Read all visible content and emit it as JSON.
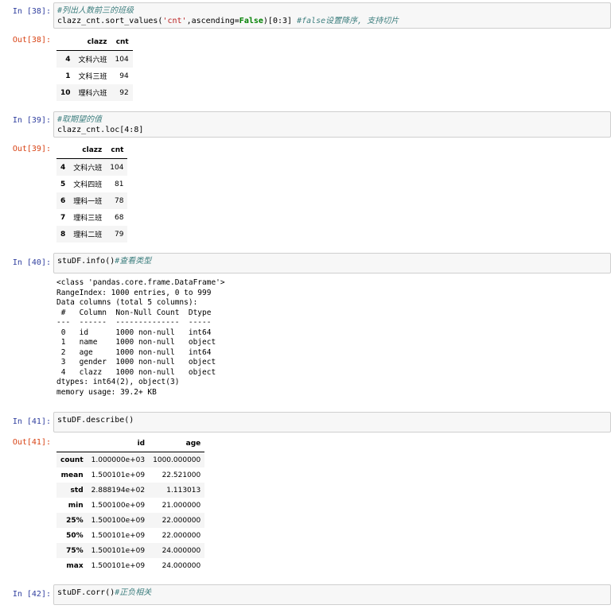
{
  "cells": [
    {
      "in_prompt": "In  [38]:",
      "code_comment": "#列出人数前三的班级",
      "code_line2_a": "clazz_cnt.sort_values(",
      "code_line2_str": "'cnt'",
      "code_line2_b": ",ascending=",
      "code_line2_kw": "False",
      "code_line2_c": ")[0:3] ",
      "code_line2_comment": "#false设置降序, 支持切片",
      "out_prompt": "Out[38]:",
      "table": {
        "headers": [
          "",
          "clazz",
          "cnt"
        ],
        "rows": [
          [
            "4",
            "文科六班",
            "104"
          ],
          [
            "1",
            "文科三班",
            "94"
          ],
          [
            "10",
            "理科六班",
            "92"
          ]
        ]
      }
    },
    {
      "in_prompt": "In  [39]:",
      "code_comment": "#取期望的值",
      "code_line2": "clazz_cnt.loc[4:8]",
      "out_prompt": "Out[39]:",
      "table": {
        "headers": [
          "",
          "clazz",
          "cnt"
        ],
        "rows": [
          [
            "4",
            "文科六班",
            "104"
          ],
          [
            "5",
            "文科四班",
            "81"
          ],
          [
            "6",
            "理科一班",
            "78"
          ],
          [
            "7",
            "理科三班",
            "68"
          ],
          [
            "8",
            "理科二班",
            "79"
          ]
        ]
      }
    },
    {
      "in_prompt": "In  [40]:",
      "code_a": "stuDF.info()",
      "code_comment": "#查看类型",
      "stdout": "<class 'pandas.core.frame.DataFrame'>\nRangeIndex: 1000 entries, 0 to 999\nData columns (total 5 columns):\n #   Column  Non-Null Count  Dtype \n---  ------  --------------  ----- \n 0   id      1000 non-null   int64 \n 1   name    1000 non-null   object\n 2   age     1000 non-null   int64 \n 3   gender  1000 non-null   object\n 4   clazz   1000 non-null   object\ndtypes: int64(2), object(3)\nmemory usage: 39.2+ KB"
    },
    {
      "in_prompt": "In  [41]:",
      "code_a": "stuDF.describe()",
      "out_prompt": "Out[41]:",
      "table": {
        "headers": [
          "",
          "id",
          "age"
        ],
        "rows": [
          [
            "count",
            "1.000000e+03",
            "1000.000000"
          ],
          [
            "mean",
            "1.500101e+09",
            "22.521000"
          ],
          [
            "std",
            "2.888194e+02",
            "1.113013"
          ],
          [
            "min",
            "1.500100e+09",
            "21.000000"
          ],
          [
            "25%",
            "1.500100e+09",
            "22.000000"
          ],
          [
            "50%",
            "1.500101e+09",
            "22.000000"
          ],
          [
            "75%",
            "1.500101e+09",
            "24.000000"
          ],
          [
            "max",
            "1.500101e+09",
            "24.000000"
          ]
        ]
      }
    },
    {
      "in_prompt": "In  [42]:",
      "code_a": "stuDF.corr()",
      "code_comment": "#正负相关"
    }
  ]
}
